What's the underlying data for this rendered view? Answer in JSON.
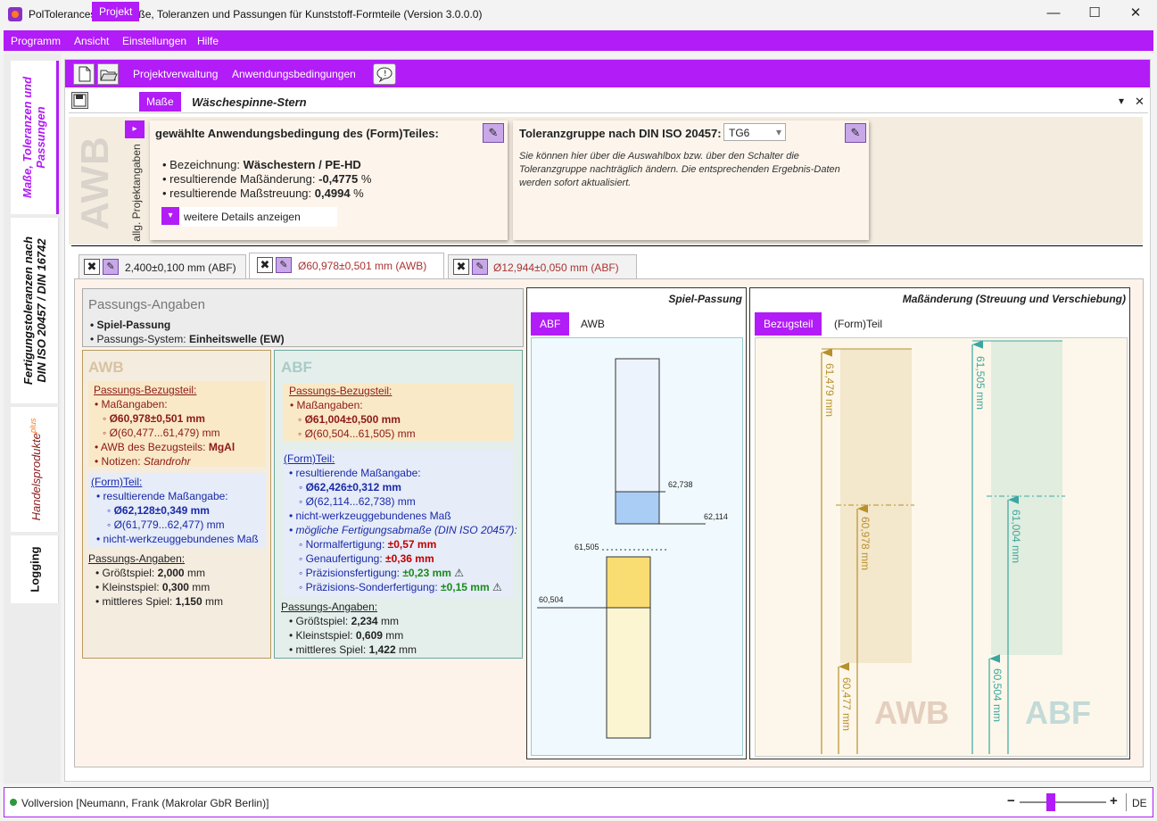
{
  "window": {
    "title": "PolTolerances-AC - Maße, Toleranzen und Passungen für Kunststoff-Formteile (Version 3.0.0.0)",
    "minimize": "—",
    "maximize": "☐",
    "close": "✕"
  },
  "menu": [
    "Programm",
    "Ansicht",
    "Einstellungen",
    "Hilfe"
  ],
  "sidetabs": {
    "t1": "Maße, Toleranzen und\nPassungen",
    "t2": "Fertigungstoleranzen nach\nDIN ISO 20457 / DIN 16742",
    "t3": "Handelsprodukte",
    "t3_sup": "plus",
    "t4": "Logging"
  },
  "toolbar": {
    "projektverwaltung": "Projektverwaltung",
    "anwendungsbedingungen": "Anwendungsbedingungen"
  },
  "docbar": {
    "projekt": "Projekt",
    "masse": "Maße",
    "title": "Wäschespinne-Stern",
    "dropdown": "▾",
    "close": "✕"
  },
  "awb": {
    "big_label": "AWB",
    "allg_label": "allg. Projektangaben",
    "card_title": "gewählte Anwendungsbedingung des (Form)Teiles:",
    "bez_label": "Bezeichnung:",
    "bez_value": "Wäschestern / PE-HD",
    "aend_label": "resultierende Maßänderung:",
    "aend_value": "-0,4775",
    "aend_unit": "%",
    "streu_label": "resultierende Maßstreuung:",
    "streu_value": "0,4994",
    "streu_unit": "%",
    "details": "weitere Details anzeigen",
    "tg_title": "Toleranzgruppe nach DIN ISO 20457:",
    "tg_value": "TG6",
    "tg_note": "Sie können hier über die Auswahlbox bzw. über den Schalter die Toleranzgruppe nachträglich ändern. Die entsprechenden Ergebnis-Daten werden sofort aktualisiert."
  },
  "tabs": [
    {
      "label": "2,400±0,100 mm (ABF)"
    },
    {
      "label": "Ø60,978±0,501 mm (AWB)"
    },
    {
      "label": "Ø12,944±0,050 mm (ABF)"
    }
  ],
  "passung": {
    "header": "Passungs-Angaben",
    "art": "Spiel-Passung",
    "system_label": "Passungs-System:",
    "system_value": "Einheitswelle (EW)"
  },
  "awbcol": {
    "title": "AWB",
    "bezug_head": "Passungs-Bezugsteil:",
    "mass_label": "Maßangaben:",
    "mass_value": "Ø60,978±0,501 mm",
    "mass_range": "Ø(60,477...61,479) mm",
    "awb_label": "AWB des Bezugsteils:",
    "awb_value": "MgAl",
    "notiz_label": "Notizen:",
    "notiz_value": "Standrohr",
    "form_head": "(Form)Teil:",
    "res_label": "resultierende Maßangabe:",
    "res_value": "Ø62,128±0,349 mm",
    "res_range": "Ø(61,779...62,477) mm",
    "nicht": "nicht-werkzeuggebundenes Maß",
    "pa_head": "Passungs-Angaben:",
    "gross_label": "Größtspiel:",
    "gross_value": "2,000",
    "klein_label": "Kleinstspiel:",
    "klein_value": "0,300",
    "mittel_label": "mittleres Spiel:",
    "mittel_value": "1,150",
    "unit": "mm"
  },
  "abfcol": {
    "title": "ABF",
    "bezug_head": "Passungs-Bezugsteil:",
    "mass_label": "Maßangaben:",
    "mass_value": "Ø61,004±0,500 mm",
    "mass_range": "Ø(60,504...61,505) mm",
    "form_head": "(Form)Teil:",
    "res_label": "resultierende Maßangabe:",
    "res_value": "Ø62,426±0,312 mm",
    "res_range": "Ø(62,114...62,738) mm",
    "nicht": "nicht-werkzeuggebundenes Maß",
    "moegl": "mögliche Fertigungsabmaße (DIN ISO 20457):",
    "normal_label": "Normalfertigung:",
    "normal_value": "±0,57 mm",
    "genau_label": "Genaufertigung:",
    "genau_value": "±0,36 mm",
    "praez_label": "Präzisionsfertigung:",
    "praez_value": "±0,23 mm",
    "sonder_label": "Präzisions-Sonderfertigung:",
    "sonder_value": "±0,15 mm",
    "warn": "⚠",
    "pa_head": "Passungs-Angaben:",
    "gross_label": "Größtspiel:",
    "gross_value": "2,234",
    "klein_label": "Kleinstspiel:",
    "klein_value": "0,609",
    "mittel_label": "mittleres Spiel:",
    "mittel_value": "1,422",
    "unit": "mm"
  },
  "spiel": {
    "title": "Spiel-Passung",
    "tab_abf": "ABF",
    "tab_awb": "AWB",
    "v62738": "62,738",
    "v62114": "62,114",
    "v61505": "61,505",
    "v60504": "60,504"
  },
  "masschart": {
    "title": "Maßänderung (Streuung und Verschiebung)",
    "tab_bezug": "Bezugsteil",
    "tab_form": "(Form)Teil",
    "awb_max": "61,479 mm",
    "awb_nom": "60,978 mm",
    "awb_min": "60,477 mm",
    "abf_max": "61,505 mm",
    "abf_nom": "61,004 mm",
    "abf_min": "60,504 mm",
    "awb_bg": "AWB",
    "abf_bg": "ABF"
  },
  "status": {
    "text": "Vollversion [Neumann, Frank (Makrolar GbR Berlin)]",
    "minus": "−",
    "plus": "+",
    "lang": "DE"
  },
  "colors": {
    "accent": "#b11cf7",
    "awb_tan": "#b89a5c",
    "abf_teal": "#6aa8a0"
  }
}
